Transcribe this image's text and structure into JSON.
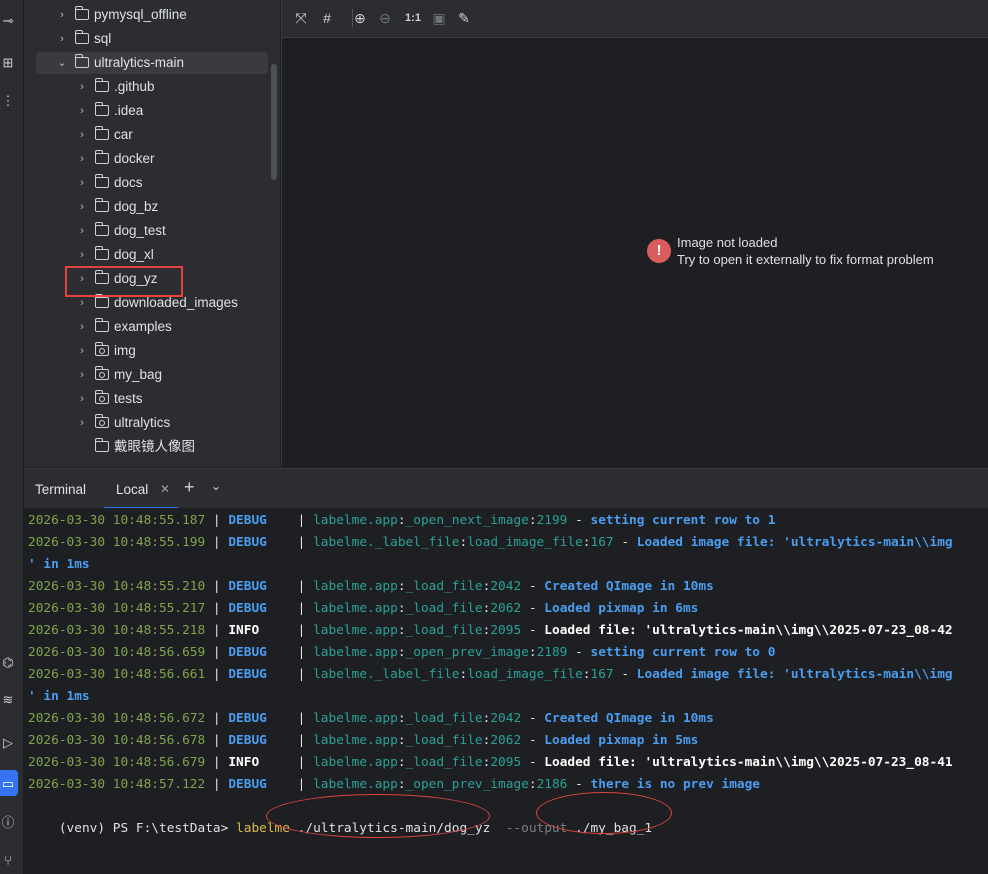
{
  "project_tree": {
    "items": [
      {
        "label": "pymysql_offline",
        "depth": 1,
        "expanded": false
      },
      {
        "label": "sql",
        "depth": 1,
        "expanded": false
      },
      {
        "label": "ultralytics-main",
        "depth": 1,
        "expanded": true
      },
      {
        "label": ".github",
        "depth": 2,
        "expanded": false
      },
      {
        "label": ".idea",
        "depth": 2,
        "expanded": false
      },
      {
        "label": "car",
        "depth": 2,
        "expanded": false
      },
      {
        "label": "docker",
        "depth": 2,
        "expanded": false
      },
      {
        "label": "docs",
        "depth": 2,
        "expanded": false
      },
      {
        "label": "dog_bz",
        "depth": 2,
        "expanded": false
      },
      {
        "label": "dog_test",
        "depth": 2,
        "expanded": false
      },
      {
        "label": "dog_xl",
        "depth": 2,
        "expanded": false
      },
      {
        "label": "dog_yz",
        "depth": 2,
        "expanded": false
      },
      {
        "label": "downloaded_images",
        "depth": 2,
        "expanded": false
      },
      {
        "label": "examples",
        "depth": 2,
        "expanded": false
      },
      {
        "label": "img",
        "depth": 2,
        "expanded": false
      },
      {
        "label": "my_bag",
        "depth": 2,
        "expanded": false
      },
      {
        "label": "tests",
        "depth": 2,
        "expanded": false
      },
      {
        "label": "ultralytics",
        "depth": 2,
        "expanded": false
      },
      {
        "label": "戴眼镜人像图",
        "depth": 2,
        "expanded": false
      }
    ]
  },
  "image_viewer": {
    "zoom_label": "1:1",
    "error_title": "Image not loaded",
    "error_message": "Try to open it externally to fix format problem"
  },
  "terminal": {
    "title": "Terminal",
    "tab_label": "Local",
    "lines": [
      {
        "ts": "2026-03-30 10:48:55.187",
        "level": "DEBUG",
        "module": "labelme.app",
        "func": "_open_next_image",
        "line": "2199",
        "msg": "setting current row to 1"
      },
      {
        "ts": "2026-03-30 10:48:55.199",
        "level": "DEBUG",
        "module": "labelme._label_file",
        "func": "load_image_file",
        "line": "167",
        "msg": "Loaded image file: 'ultralytics-main\\\\img"
      },
      {
        "wrap": "' in 1ms"
      },
      {
        "ts": "2026-03-30 10:48:55.210",
        "level": "DEBUG",
        "module": "labelme.app",
        "func": "_load_file",
        "line": "2042",
        "msg": "Created QImage in 10ms"
      },
      {
        "ts": "2026-03-30 10:48:55.217",
        "level": "DEBUG",
        "module": "labelme.app",
        "func": "_load_file",
        "line": "2062",
        "msg": "Loaded pixmap in 6ms"
      },
      {
        "ts": "2026-03-30 10:48:55.218",
        "level": "INFO",
        "module": "labelme.app",
        "func": "_load_file",
        "line": "2095",
        "msg": "Loaded file: 'ultralytics-main\\\\img\\\\2025-07-23_08-42"
      },
      {
        "ts": "2026-03-30 10:48:56.659",
        "level": "DEBUG",
        "module": "labelme.app",
        "func": "_open_prev_image",
        "line": "2189",
        "msg": "setting current row to 0"
      },
      {
        "ts": "2026-03-30 10:48:56.661",
        "level": "DEBUG",
        "module": "labelme._label_file",
        "func": "load_image_file",
        "line": "167",
        "msg": "Loaded image file: 'ultralytics-main\\\\img"
      },
      {
        "wrap": "' in 1ms"
      },
      {
        "ts": "2026-03-30 10:48:56.672",
        "level": "DEBUG",
        "module": "labelme.app",
        "func": "_load_file",
        "line": "2042",
        "msg": "Created QImage in 10ms"
      },
      {
        "ts": "2026-03-30 10:48:56.678",
        "level": "DEBUG",
        "module": "labelme.app",
        "func": "_load_file",
        "line": "2062",
        "msg": "Loaded pixmap in 5ms"
      },
      {
        "ts": "2026-03-30 10:48:56.679",
        "level": "INFO",
        "module": "labelme.app",
        "func": "_load_file",
        "line": "2095",
        "msg": "Loaded file: 'ultralytics-main\\\\img\\\\2025-07-23_08-41"
      },
      {
        "ts": "2026-03-30 10:48:57.122",
        "level": "DEBUG",
        "module": "labelme.app",
        "func": "_open_prev_image",
        "line": "2186",
        "msg": "there is no prev image"
      }
    ],
    "prompt": {
      "prefix": "(venv) PS F:\\testData> ",
      "command": "labelme",
      "arg1": " ./ultralytics-main/dog_yz",
      "flag": "  --output",
      "arg2": " ./my_bag_1"
    }
  },
  "colors": {
    "accent": "#3574f0",
    "annotation": "#e5423f",
    "error": "#db5c5c"
  }
}
